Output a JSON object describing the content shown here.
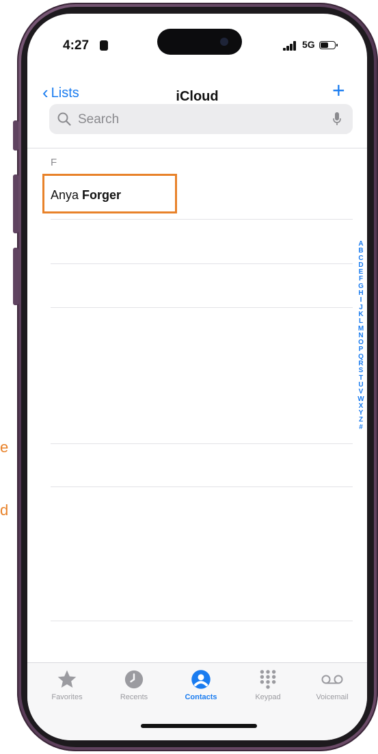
{
  "side_note": {
    "line1": "e",
    "line2": "d"
  },
  "status_bar": {
    "time": "4:27",
    "network": "5G"
  },
  "nav": {
    "back_label": "Lists",
    "title": "iCloud",
    "add_label": "+"
  },
  "search": {
    "placeholder": "Search"
  },
  "contacts": {
    "section": "F",
    "items": [
      {
        "first": "Anya",
        "last": "Forger"
      }
    ]
  },
  "index_letters": [
    "A",
    "B",
    "C",
    "D",
    "E",
    "F",
    "G",
    "H",
    "I",
    "J",
    "K",
    "L",
    "M",
    "N",
    "O",
    "P",
    "Q",
    "R",
    "S",
    "T",
    "U",
    "V",
    "W",
    "X",
    "Y",
    "Z",
    "#"
  ],
  "tabs": [
    {
      "label": "Favorites",
      "icon": "star-icon",
      "active": false
    },
    {
      "label": "Recents",
      "icon": "clock-icon",
      "active": false
    },
    {
      "label": "Contacts",
      "icon": "person-circle-icon",
      "active": true
    },
    {
      "label": "Keypad",
      "icon": "keypad-icon",
      "active": false
    },
    {
      "label": "Voicemail",
      "icon": "voicemail-icon",
      "active": false
    }
  ],
  "colors": {
    "accent": "#1a7cf0",
    "highlight": "#e8822a",
    "frame": "#5f4360"
  }
}
